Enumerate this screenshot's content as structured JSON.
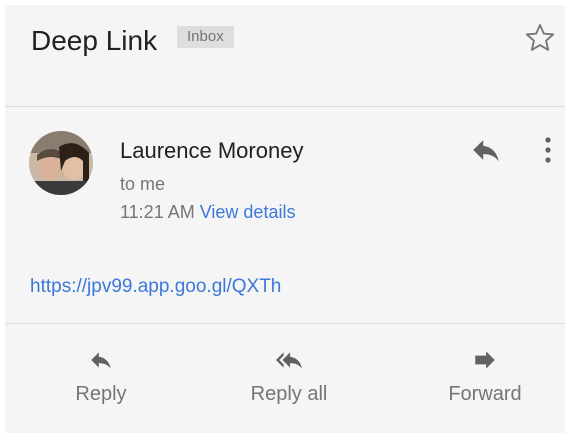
{
  "header": {
    "subject": "Deep Link",
    "label": "Inbox",
    "star_icon": "star-outline-icon"
  },
  "message": {
    "sender": "Laurence Moroney",
    "recipient": "to me",
    "time": "11:21 AM",
    "details_link": "View details",
    "body_link": "https://jpv99.app.goo.gl/QXTh",
    "icons": [
      "reply-icon",
      "more-vertical-icon"
    ]
  },
  "actions": {
    "reply": "Reply",
    "reply_all": "Reply all",
    "forward": "Forward"
  },
  "colors": {
    "background": "#f5f5f5",
    "link": "#3c78d8",
    "icon": "#616161",
    "badge": "#dedede"
  }
}
